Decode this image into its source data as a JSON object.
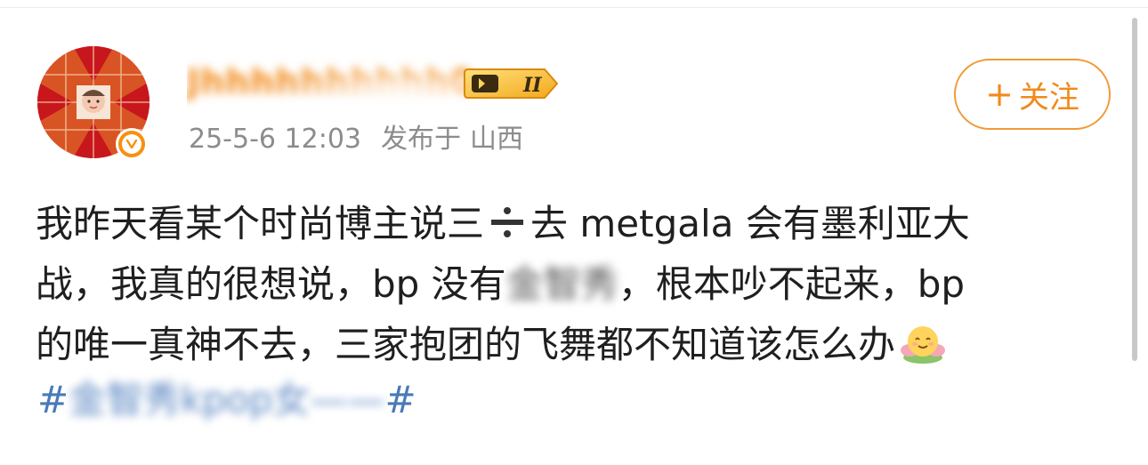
{
  "post": {
    "user": {
      "name": "Jhhhhhhhhhh0",
      "verified": true,
      "member_badge_text": "II"
    },
    "meta": {
      "datetime": "25-5-6 12:03",
      "location_label": "发布于",
      "location": "山西"
    },
    "follow_button": {
      "plus": "+",
      "label": "关注"
    },
    "content": {
      "line1_before": "我昨天看某个时尚博主说三",
      "line1_after": "去 metgala 会有墨利亚大",
      "line2_before": "战，我真的很想说，bp 没有",
      "line2_blurred": "金智秀",
      "line2_after": "，根本吵不起来，bp",
      "line3": "的唯一真神不去，三家抱团的飞舞都不知道该怎么办"
    },
    "hashtag": {
      "hash_open": "#",
      "text_blurred": "金智秀kpop女——",
      "hash_close": "#"
    }
  },
  "colors": {
    "accent": "#f28a1a",
    "meta": "#8c8c8c",
    "hashtag": "#4a79b7",
    "text": "#1f1f1f"
  }
}
